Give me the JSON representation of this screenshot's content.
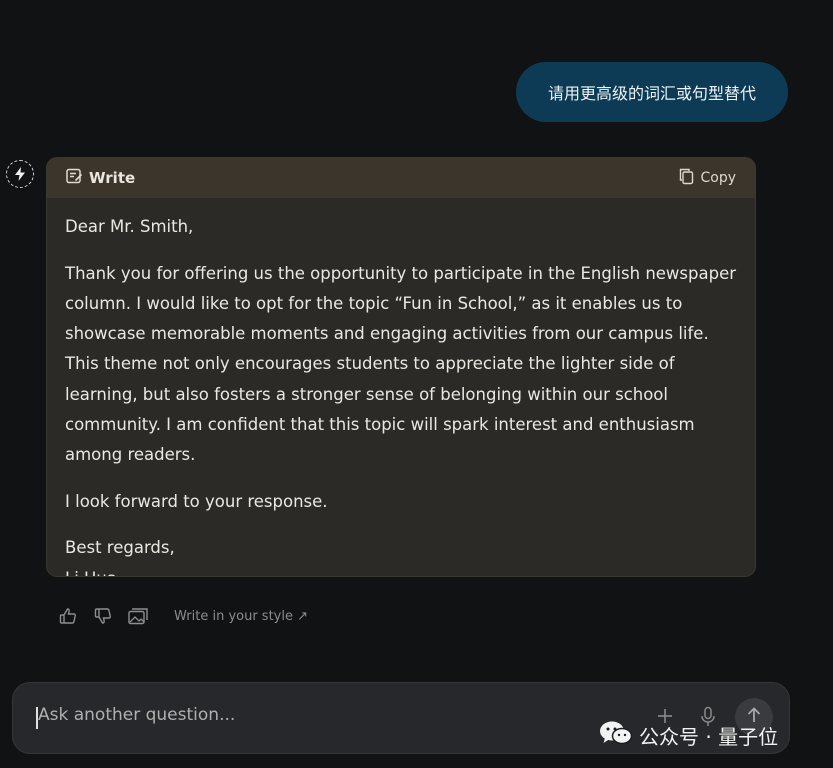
{
  "user_message": "请用更高级的词汇或句型替代",
  "card": {
    "write_label": "Write",
    "copy_label": "Copy"
  },
  "letter": {
    "greeting": "Dear Mr. Smith,",
    "paragraph1": "Thank you for offering us the opportunity to participate in the English newspaper column. I would like to opt for the topic “Fun in School,” as it enables us to showcase memorable moments and engaging activities from our campus life. This theme not only encourages students to appreciate the lighter side of learning, but also fosters a stronger sense of belonging within our school community. I am confident that this topic will spark interest and enthusiasm among readers.",
    "paragraph2": "I look forward to your response.",
    "closing": "Best regards,",
    "signature": "Li Hua"
  },
  "actions": {
    "write_style_label": "Write in your style ↗"
  },
  "input": {
    "placeholder": "Ask another question..."
  },
  "watermark": "公众号 · 量子位",
  "icons": [
    "bot-avatar-icon",
    "write-icon",
    "copy-icon",
    "thumbs-up-icon",
    "thumbs-down-icon",
    "image-icon",
    "plus-icon",
    "mic-icon",
    "send-arrow-icon",
    "wechat-icon"
  ]
}
